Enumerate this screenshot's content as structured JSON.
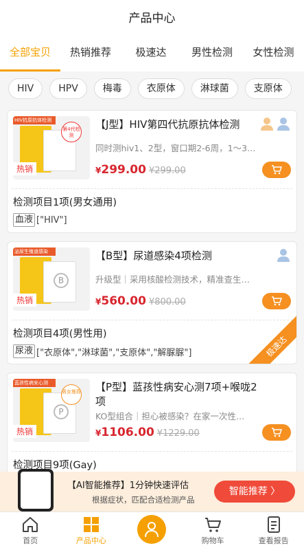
{
  "header": {
    "title": "产品中心"
  },
  "tabs": [
    {
      "label": "全部宝贝",
      "active": true
    },
    {
      "label": "热销推荐",
      "active": false
    },
    {
      "label": "极速达",
      "active": false
    },
    {
      "label": "男性检测",
      "active": false
    },
    {
      "label": "女性检测",
      "active": false
    }
  ],
  "chips": [
    "HIV",
    "HPV",
    "梅毒",
    "衣原体",
    "淋球菌",
    "支原体"
  ],
  "products": [
    {
      "title": "【J型】HIV第四代抗原抗体检测",
      "desc": "同时测hiv1、2型，窗口期2-6周，1～3…",
      "price_symbol": "¥",
      "price": "299.00",
      "orig_price": "¥299.00",
      "hot_label": "热销",
      "thumb_banner": "HIV抗原抗体检测",
      "thumb_seal": "第4代检测",
      "detect_count": "检测项目1项(男女通用)",
      "sample_type": "血液",
      "items": "[\"HIV\"]"
    },
    {
      "title": "【B型】尿道感染4项检测",
      "desc": "升级型｜采用核酸检测技术，精准查生…",
      "price_symbol": "¥",
      "price": "560.00",
      "orig_price": "¥800.00",
      "hot_label": "热销",
      "thumb_banner": "泌尿生殖道感染",
      "thumb_letter": "B",
      "detect_count": "检测项目4项(男性用)",
      "sample_type": "尿液",
      "items": "[\"衣原体\",\"淋球菌\",\"支原体\",\"解脲脲\"]",
      "ribbon": "极速达"
    },
    {
      "title": "【P型】蓝孩性病安心测7项+喉咙2项",
      "desc": "KO型组合｜担心被感染？在家一次性…",
      "price_symbol": "¥",
      "price": "1106.00",
      "orig_price": "¥1229.00",
      "hot_label": "热销",
      "thumb_banner": "蓝孩性病安心测",
      "thumb_seal": "男女推荐",
      "thumb_letter": "P",
      "detect_count": "检测项目9项(Gay)"
    }
  ],
  "promo": {
    "title": "【AI智能推荐】1分钟快速评估",
    "subtitle": "根据症状，匹配合适检测产品",
    "button": "智能推荐 〉"
  },
  "nav": [
    {
      "label": "首页",
      "icon": "home-icon",
      "active": false
    },
    {
      "label": "产品中心",
      "icon": "grid-icon",
      "active": true
    },
    {
      "label": "",
      "icon": "doctor-icon",
      "active": false
    },
    {
      "label": "购物车",
      "icon": "cart-icon",
      "active": false
    },
    {
      "label": "查看报告",
      "icon": "report-icon",
      "active": false
    }
  ],
  "colors": {
    "accent": "#f5a000",
    "price": "#d8262f",
    "cart": "#f59021",
    "promo_btn": "#f04b3a"
  }
}
